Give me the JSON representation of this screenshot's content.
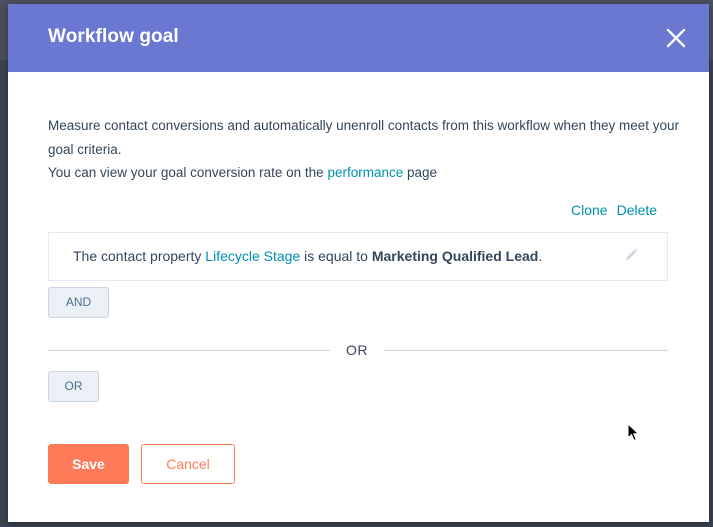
{
  "modal": {
    "title": "Workflow goal",
    "close_icon": "close-icon",
    "header_color": "#6a78d1"
  },
  "description": {
    "line1": "Measure contact conversions and automatically unenroll contacts from this workflow when they meet your goal criteria.",
    "line2_prefix": "You can view your goal conversion rate on the ",
    "line2_link": "performance",
    "line2_suffix": " page"
  },
  "card_actions": {
    "clone": "Clone",
    "delete": "Delete"
  },
  "filter": {
    "prefix": "The contact property ",
    "property": "Lifecycle Stage",
    "operator": " is equal to ",
    "value": "Marketing Qualified Lead",
    "suffix": ".",
    "edit_icon": "pencil-icon"
  },
  "buttons": {
    "and": "AND",
    "or": "OR",
    "save": "Save",
    "cancel": "Cancel"
  },
  "divider": {
    "text": "OR"
  },
  "colors": {
    "link": "#0091ae",
    "primary": "#ff7a59",
    "text": "#33475b"
  }
}
